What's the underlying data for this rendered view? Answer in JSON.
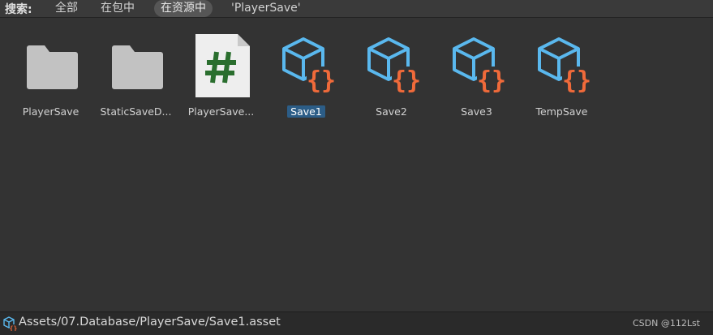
{
  "search": {
    "label": "搜索:",
    "options": [
      {
        "label": "全部",
        "selected": false
      },
      {
        "label": "在包中",
        "selected": false
      },
      {
        "label": "在资源中",
        "selected": true
      }
    ],
    "term": "'PlayerSave'"
  },
  "assets": [
    {
      "name": "PlayerSave",
      "icon": "folder-icon",
      "selected": false
    },
    {
      "name": "StaticSaveD...",
      "icon": "folder-icon",
      "selected": false
    },
    {
      "name": "PlayerSave...",
      "icon": "csharp-script-icon",
      "selected": false
    },
    {
      "name": "Save1",
      "icon": "scriptable-object-icon",
      "selected": true
    },
    {
      "name": "Save2",
      "icon": "scriptable-object-icon",
      "selected": false
    },
    {
      "name": "Save3",
      "icon": "scriptable-object-icon",
      "selected": false
    },
    {
      "name": "TempSave",
      "icon": "scriptable-object-icon",
      "selected": false
    }
  ],
  "status": {
    "path": "Assets/07.Database/PlayerSave/Save1.asset",
    "watermark": "CSDN @112Lst"
  },
  "colors": {
    "selection": "#2c5d87",
    "folder": "#c2c2c2",
    "cube": "#5ab8ee",
    "braces": "#f06a3a",
    "hash": "#2a6e2e"
  }
}
